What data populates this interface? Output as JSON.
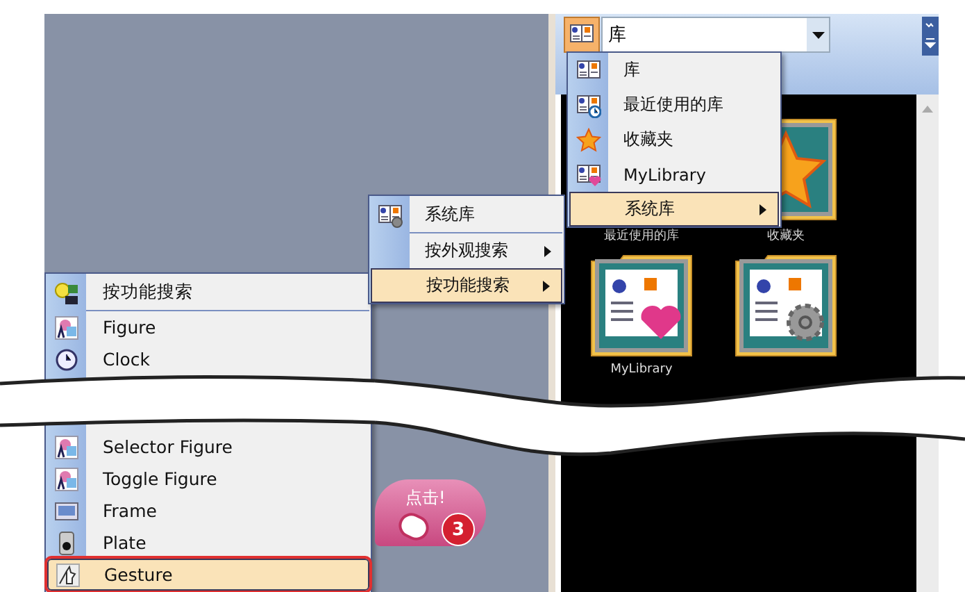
{
  "combo": {
    "value": "库"
  },
  "library_menu": {
    "items": [
      {
        "label": "库",
        "kind": "library",
        "selected": false,
        "has_submenu": false
      },
      {
        "label": "最近使用的库",
        "kind": "recent",
        "selected": false,
        "has_submenu": false
      },
      {
        "label": "收藏夹",
        "kind": "favorites",
        "selected": false,
        "has_submenu": false
      },
      {
        "label": "MyLibrary",
        "kind": "mylibrary",
        "selected": false,
        "has_submenu": false
      },
      {
        "label": "系统库",
        "kind": "plain",
        "selected": true,
        "has_submenu": true
      }
    ]
  },
  "search_menu": {
    "items": [
      {
        "label": "系统库",
        "kind": "header",
        "selected": false,
        "has_submenu": false
      },
      {
        "label": "按外观搜索",
        "kind": "plain",
        "selected": false,
        "has_submenu": true
      },
      {
        "label": "按功能搜索",
        "kind": "plain",
        "selected": true,
        "has_submenu": true
      }
    ]
  },
  "function_menu": {
    "items": [
      {
        "label": "按功能搜索",
        "kind": "header",
        "selected": false,
        "outlined": false
      },
      {
        "label": "Figure",
        "kind": "figure",
        "selected": false,
        "outlined": false
      },
      {
        "label": "Clock",
        "kind": "clock",
        "selected": false,
        "outlined": false
      },
      {
        "kind": "gap"
      },
      {
        "label": "Selector Figure",
        "kind": "figure",
        "selected": false,
        "outlined": false
      },
      {
        "label": "Toggle Figure",
        "kind": "figure",
        "selected": false,
        "outlined": false
      },
      {
        "label": "Frame",
        "kind": "frame",
        "selected": false,
        "outlined": false
      },
      {
        "label": "Plate",
        "kind": "plate",
        "selected": false,
        "outlined": false
      },
      {
        "label": "Gesture",
        "kind": "gesture",
        "selected": true,
        "outlined": true
      }
    ]
  },
  "folders": [
    {
      "label": "最近使用的库",
      "kind": "recent"
    },
    {
      "label": "收藏夹",
      "kind": "favorites"
    },
    {
      "label": "MyLibrary",
      "kind": "mylibrary"
    },
    {
      "kind": "system"
    }
  ],
  "callout": {
    "text": "点击!",
    "step": "3"
  }
}
